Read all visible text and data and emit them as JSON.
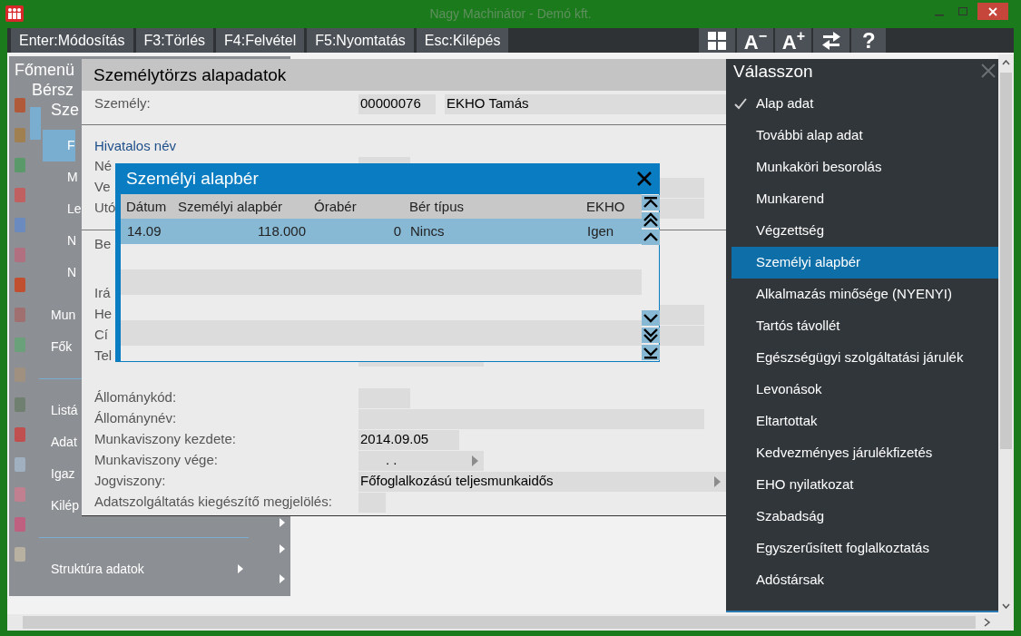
{
  "window": {
    "title": "Nagy Machinátor - Demó kft."
  },
  "toolbar": {
    "commands": [
      {
        "key": "Enter:",
        "label": "Módosítás"
      },
      {
        "key": "F3:",
        "label": "Törlés"
      },
      {
        "key": "F4:",
        "label": "Felvétel"
      },
      {
        "key": "F5:",
        "label": "Nyomtatás"
      },
      {
        "key": "Esc:",
        "label": "Kilépés"
      }
    ],
    "tools": [
      {
        "kind": "grid"
      },
      {
        "kind": "font",
        "label": "A",
        "sign": "−"
      },
      {
        "kind": "font",
        "label": "A",
        "sign": "+"
      },
      {
        "kind": "swap"
      },
      {
        "kind": "help",
        "label": "?"
      }
    ]
  },
  "sidebar": {
    "tree": [
      {
        "label": "Főmenü",
        "children": [
          {
            "label": "Bérsz",
            "children": [
              {
                "label": "Sze",
                "expanded": true,
                "children": [
                  {
                    "label": "F",
                    "selected": true
                  },
                  {
                    "label": "M",
                    "selected": false
                  },
                  {
                    "label": "Le",
                    "selected": false
                  },
                  {
                    "label": "N",
                    "selected": false
                  },
                  {
                    "label": "N",
                    "selected": false
                  }
                ]
              },
              {
                "label": "Mun",
                "selected": false
              },
              {
                "label": "Fők",
                "selected": false
              },
              {
                "label": "Listá",
                "selected": false,
                "separator_before": true
              },
              {
                "label": "Adat",
                "selected": false
              },
              {
                "label": "Igaz",
                "selected": false
              },
              {
                "label": "Kilép",
                "selected": false,
                "arrow": true
              },
              {
                "kind": "blank",
                "separator_before": true,
                "arrow": true
              },
              {
                "label": "Struktúra adatok",
                "selected": false,
                "submenu": true,
                "arrow": true
              }
            ]
          }
        ]
      }
    ]
  },
  "form": {
    "title": "Személytörzs alapadatok",
    "sections": [
      {
        "groups": [
          [
            {
              "label": "Személy:",
              "fields": [
                {
                  "kind": "id",
                  "value": "00000076"
                },
                {
                  "kind": "name",
                  "value": "EKHO Tamás"
                }
              ]
            }
          ]
        ]
      },
      {
        "heading": "Hivatalos név",
        "groups": [
          [
            {
              "label": "Né",
              "fields": [
                {
                  "kind": "code"
                }
              ]
            },
            {
              "label": "Ve",
              "fields": [
                {
                  "kind": "long"
                }
              ]
            },
            {
              "label": "Utó",
              "fields": [
                {
                  "kind": "long"
                }
              ]
            }
          ]
        ]
      },
      {
        "groups": [
          [
            {
              "label": "Be"
            }
          ],
          [
            {
              "label": "Irá"
            },
            {
              "label": "He",
              "fields": [
                {
                  "kind": "long"
                }
              ]
            },
            {
              "label": "Cí",
              "fields": [
                {
                  "kind": "long"
                }
              ]
            },
            {
              "label": "Tel",
              "fields": [
                {
                  "kind": "phone"
                }
              ]
            }
          ],
          [
            {
              "label": "Állománykód:",
              "fields": [
                {
                  "kind": "code"
                }
              ]
            },
            {
              "label": "Állománynév:",
              "fields": [
                {
                  "kind": "long"
                }
              ]
            },
            {
              "label": "Munkaviszony kezdete:",
              "fields": [
                {
                  "kind": "date",
                  "value": "2014.09.05"
                }
              ]
            },
            {
              "label": "Munkaviszony vége:",
              "fields": [
                {
                  "kind": "date-select",
                  "value": ".  ."
                }
              ]
            },
            {
              "label": "Jogviszony:",
              "fields": [
                {
                  "kind": "select",
                  "value": "Főfoglalkozású teljesmunkaidős"
                }
              ]
            },
            {
              "label": "Adatszolgáltatás kiegészítő megjelölés:",
              "fields": [
                {
                  "kind": "flag"
                }
              ]
            }
          ]
        ]
      }
    ]
  },
  "dialog": {
    "title": "Személyi alapbér",
    "table": {
      "columns": [
        "Dátum",
        "Személyi alapbér",
        "Órabér",
        "Bér típus",
        "EKHO"
      ],
      "rows": [
        {
          "selected": true,
          "cells": [
            "14.09",
            "118.000",
            "0",
            "Nincs",
            "Igen"
          ]
        }
      ]
    }
  },
  "chooser": {
    "title": "Válasszon",
    "items": [
      {
        "label": "Alap adat",
        "checked": true,
        "selected": false
      },
      {
        "label": "További alap adat",
        "checked": false,
        "selected": false
      },
      {
        "label": "Munkaköri besorolás",
        "checked": false,
        "selected": false
      },
      {
        "label": "Munkarend",
        "checked": false,
        "selected": false
      },
      {
        "label": "Végzettség",
        "checked": false,
        "selected": false
      },
      {
        "label": "Személyi alapbér",
        "checked": false,
        "selected": true
      },
      {
        "label": "Alkalmazás minősége (NYENYI)",
        "checked": false,
        "selected": false
      },
      {
        "label": "Tartós távollét",
        "checked": false,
        "selected": false
      },
      {
        "label": "Egészségügyi szolgáltatási járulék",
        "checked": false,
        "selected": false
      },
      {
        "label": "Levonások",
        "checked": false,
        "selected": false
      },
      {
        "label": "Eltartottak",
        "checked": false,
        "selected": false
      },
      {
        "label": "Kedvezményes járulékfizetés",
        "checked": false,
        "selected": false
      },
      {
        "label": "EHO nyilatkozat",
        "checked": false,
        "selected": false
      },
      {
        "label": "Szabadság",
        "checked": false,
        "selected": false
      },
      {
        "label": "Egyszerűsített foglalkoztatás",
        "checked": false,
        "selected": false
      },
      {
        "label": "Adóstársak",
        "checked": false,
        "selected": false
      }
    ]
  }
}
